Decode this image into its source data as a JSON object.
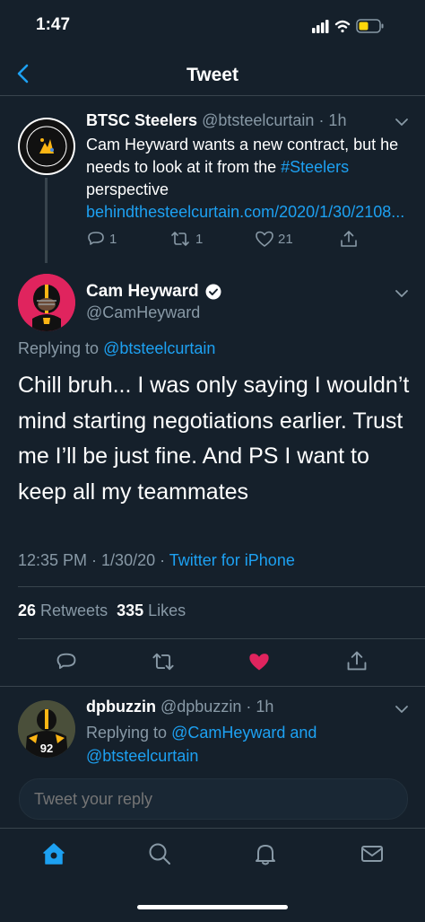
{
  "status_bar": {
    "time": "1:47"
  },
  "nav": {
    "title": "Tweet"
  },
  "parent_tweet": {
    "name": "BTSC Steelers",
    "handle": "@btsteelcurtain",
    "time": "· 1h",
    "text_before": "Cam Heyward wants a new contract, but he needs to look at it from the ",
    "hashtag": "#Steelers",
    "text_mid": " perspective ",
    "url": "behindthesteelcurtain.com/2020/1/30/2108...",
    "reply_count": "1",
    "retweet_count": "1",
    "like_count": "21"
  },
  "main_tweet": {
    "name": "Cam Heyward",
    "handle": "@CamHeyward",
    "replying_prefix": "Replying to ",
    "replying_to": "@btsteelcurtain",
    "text": "Chill bruh... I was only saying I wouldn’t mind starting negotiations earlier. Trust me I’ll be just fine. And PS I want to keep all my teammates",
    "meta_time": "12:35 PM · 1/30/20 · ",
    "source": "Twitter for iPhone",
    "retweets_num": "26",
    "retweets_label": " Retweets",
    "likes_num": "335",
    "likes_label": " Likes"
  },
  "reply_tweet": {
    "name": "dpbuzzin",
    "handle": "@dpbuzzin",
    "time": "· 1h",
    "replying_prefix": "Replying to ",
    "replying_to_1": "@CamHeyward",
    "and": " and ",
    "replying_to_2": "@btsteelcurtain"
  },
  "composer": {
    "placeholder": "Tweet your reply"
  },
  "colors": {
    "background": "#15202b",
    "accent": "#1da1f2",
    "like": "#e0245e",
    "muted": "#8899a6"
  }
}
